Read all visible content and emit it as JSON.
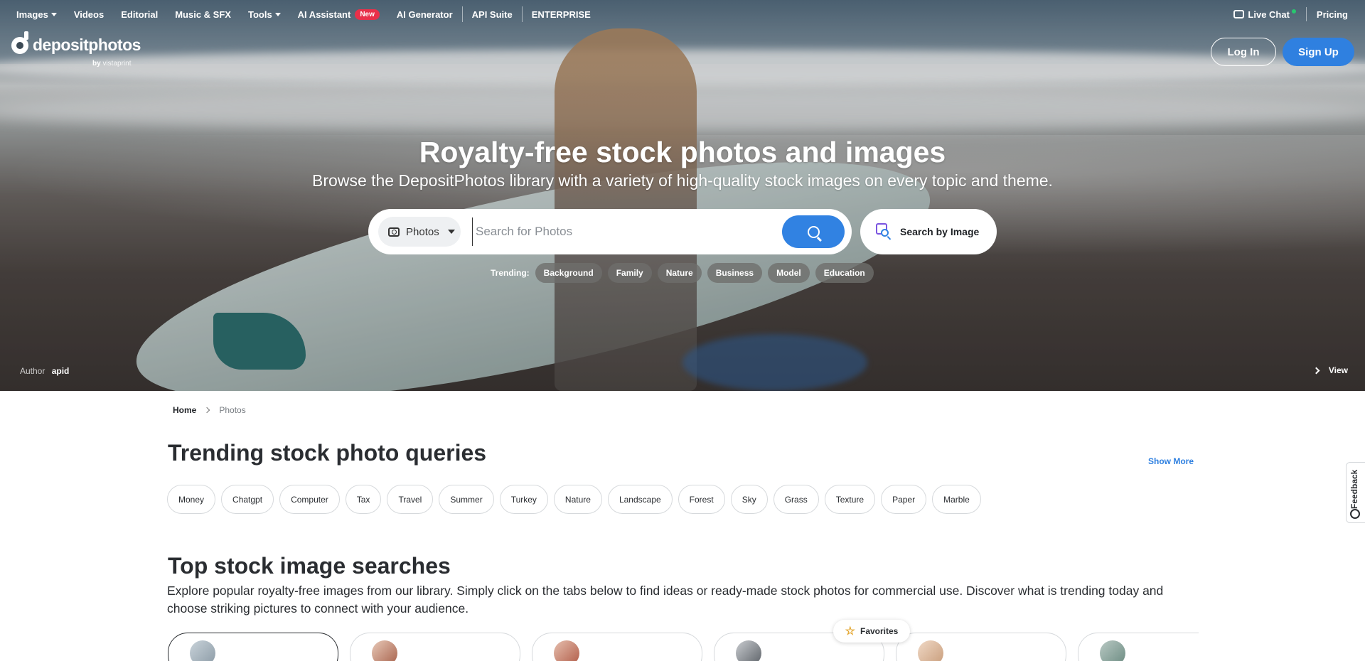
{
  "nav": {
    "items": [
      {
        "label": "Images",
        "caret": true
      },
      {
        "label": "Videos",
        "caret": false
      },
      {
        "label": "Editorial",
        "caret": false
      },
      {
        "label": "Music & SFX",
        "caret": false
      },
      {
        "label": "Tools",
        "caret": true
      },
      {
        "label": "AI Assistant",
        "caret": false
      },
      {
        "label": "AI Generator",
        "caret": false
      },
      {
        "label": "API Suite",
        "caret": false
      },
      {
        "label": "ENTERPRISE",
        "caret": false
      }
    ],
    "new_badge": "New",
    "live_chat": "Live Chat",
    "pricing": "Pricing"
  },
  "logo": {
    "text": "depositphotos",
    "by": "by",
    "partner": "vistaprint"
  },
  "auth": {
    "login": "Log In",
    "signup": "Sign Up"
  },
  "hero": {
    "title": "Royalty-free stock photos and images",
    "subtitle": "Browse the DepositPhotos library with a variety of high-quality stock images on every topic and theme.",
    "search_type": "Photos",
    "search_placeholder": "Search for Photos",
    "search_by_image": "Search by Image",
    "trending_label": "Trending:",
    "trending": [
      "Background",
      "Family",
      "Nature",
      "Business",
      "Model",
      "Education"
    ],
    "author_label": "Author",
    "author_name": "apid",
    "view": "View"
  },
  "breadcrumb": {
    "home": "Home",
    "current": "Photos"
  },
  "trending_queries": {
    "title": "Trending stock photo queries",
    "show_more": "Show More",
    "items": [
      "Money",
      "Chatgpt",
      "Computer",
      "Tax",
      "Travel",
      "Summer",
      "Turkey",
      "Nature",
      "Landscape",
      "Forest",
      "Sky",
      "Grass",
      "Texture",
      "Paper",
      "Marble"
    ]
  },
  "top_searches": {
    "title": "Top stock image searches",
    "description": "Explore popular royalty-free images from our library. Simply click on the tabs below to find ideas or ready-made stock photos for commercial use. Discover what is trending today and choose striking pictures to connect with your audience."
  },
  "favorites": "Favorites",
  "feedback": "Feedback",
  "colors": {
    "accent": "#2f80e0",
    "badge": "#e8304a",
    "online": "#28c76f"
  }
}
